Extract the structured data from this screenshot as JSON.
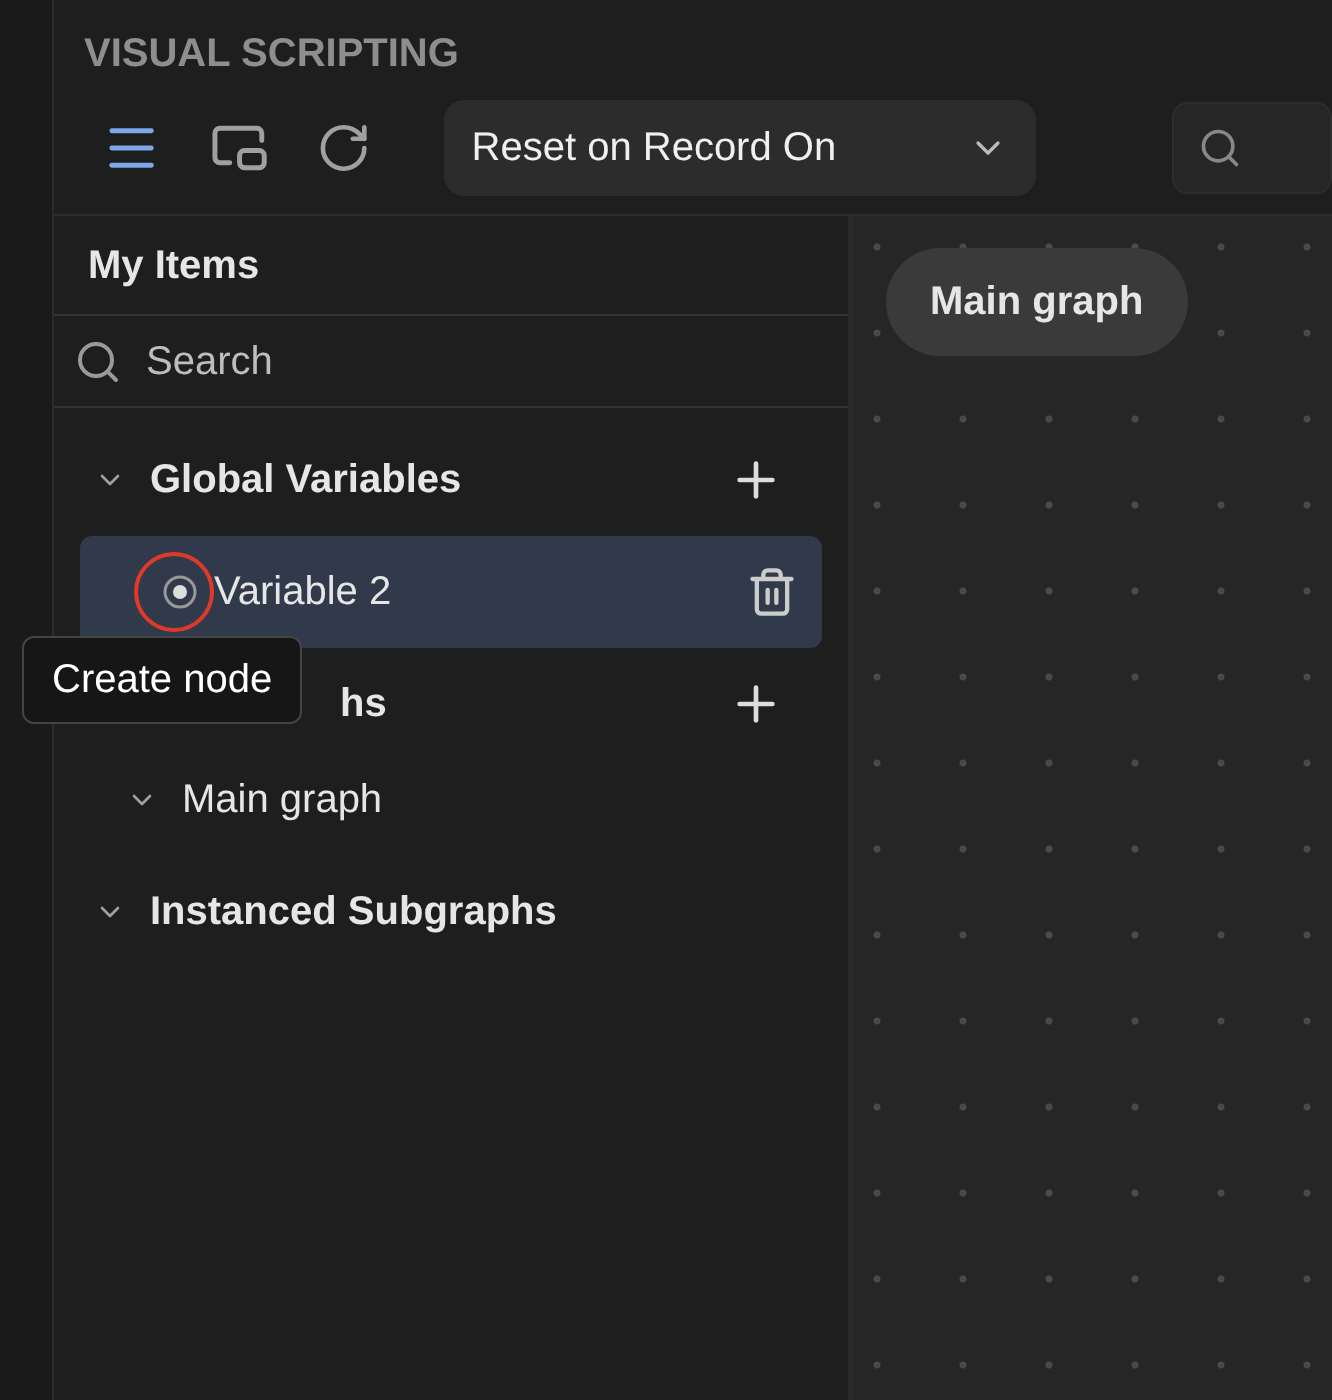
{
  "title": "VISUAL SCRIPTING",
  "toolbar": {
    "menu_selected": true,
    "dropdown": {
      "value": "Reset on Record On"
    }
  },
  "panel": {
    "title": "My Items",
    "search": {
      "placeholder": "Search"
    },
    "sections": [
      {
        "label": "Global Variables",
        "expanded": true,
        "addable": true,
        "children": [
          {
            "label": "Variable 2",
            "selected": true
          }
        ]
      },
      {
        "label": "hs",
        "expanded": true,
        "addable": true,
        "children": [
          {
            "label": "Main graph",
            "expanded": true
          }
        ]
      },
      {
        "label": "Instanced Subgraphs",
        "expanded": true,
        "addable": false
      }
    ]
  },
  "tooltip": "Create node",
  "canvas": {
    "graph_label": "Main graph"
  }
}
